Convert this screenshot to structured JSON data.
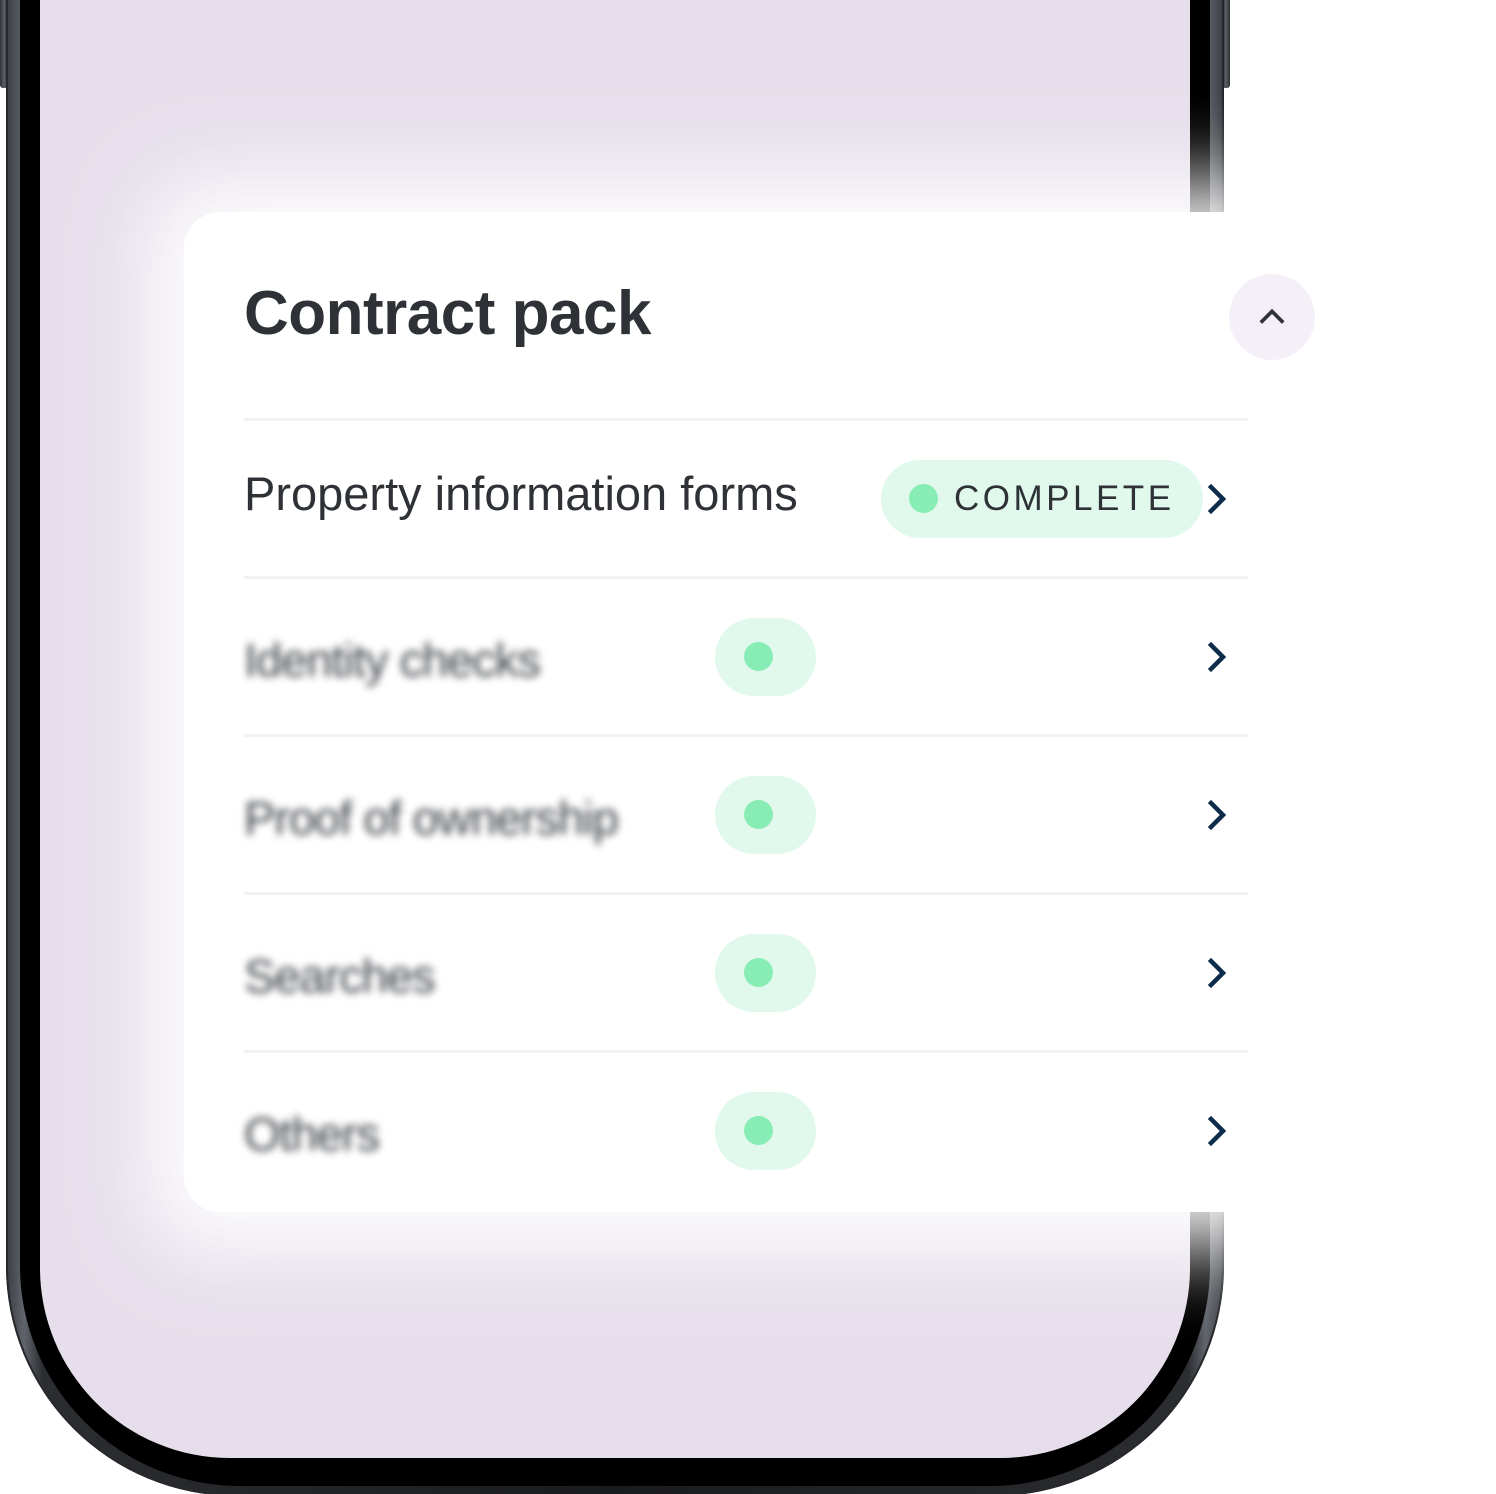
{
  "card": {
    "title": "Contract pack",
    "collapse_icon": "chevron-up-icon",
    "rows": [
      {
        "label": "Property information forms",
        "status": "COMPLETE",
        "status_color": "#88ecb5",
        "blurred": false,
        "icon": "chevron-right-icon"
      },
      {
        "label": "Identity checks",
        "status": "",
        "status_color": "#88ecb5",
        "blurred": true,
        "icon": "chevron-right-icon"
      },
      {
        "label": "Proof of ownership",
        "status": "",
        "status_color": "#88ecb5",
        "blurred": true,
        "icon": "chevron-right-icon"
      },
      {
        "label": "Searches",
        "status": "",
        "status_color": "#88ecb5",
        "blurred": true,
        "icon": "chevron-right-icon"
      },
      {
        "label": "Others",
        "status": "",
        "status_color": "#88ecb5",
        "blurred": true,
        "icon": "chevron-right-icon"
      }
    ]
  },
  "colors": {
    "screen_background": "#e6dfeb",
    "pill_background": "#e0f9ec",
    "status_dot": "#88ecb5",
    "chevron": "#0d2b4a",
    "title_text": "#2e3236"
  }
}
